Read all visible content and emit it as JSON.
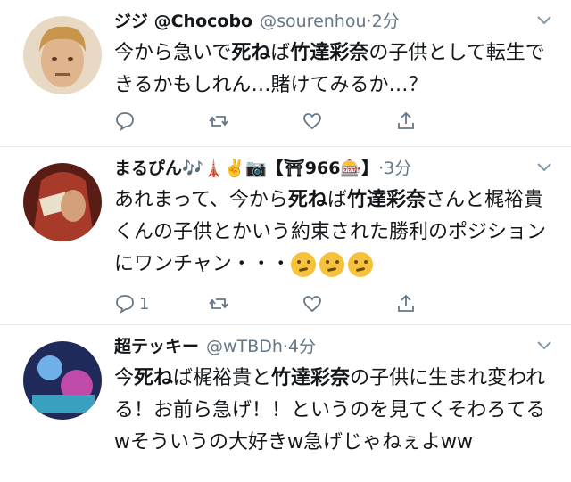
{
  "tweets": [
    {
      "name": "ジジ @Chocobo",
      "handle": "@sourenhou",
      "time": "2分",
      "body_pre": "今から急いで",
      "body_bold1": "死ね",
      "body_mid1": "ば",
      "body_bold2": "竹達彩奈",
      "body_post": "の子供として転生できるかもしれん…賭けてみるか…？",
      "reply_count": "",
      "avatar_color": "#c9a27a"
    },
    {
      "name": "まるぴん🎶🗼✌️📷【⛩966🎰】",
      "handle": "",
      "time": "3分",
      "body_pre": "あれまって、今から",
      "body_bold1": "死ね",
      "body_mid1": "ば",
      "body_bold2": "竹達彩奈",
      "body_post": "さんと梶裕貴くんの子供とかいう約束された勝利のポジションにワンチャン・・・",
      "reply_count": "1",
      "avatar_color": "#8a2e22"
    },
    {
      "name": "超テッキー",
      "handle": "@wTBDh",
      "time": "4分",
      "body_pre": "今",
      "body_bold1": "死ね",
      "body_mid1": "ば梶裕貴と",
      "body_bold2": "竹達彩奈",
      "body_post": "の子供に生まれ変われる！お前ら急げ！！というのを見てくそわろてるwそういうの大好きw急げじゃねぇよww",
      "reply_count": "",
      "avatar_color": "#3a5fa8"
    }
  ],
  "colors": {
    "text": "#14171a",
    "muted": "#657786",
    "divider": "#e6ecf0"
  },
  "icons": [
    "reply-icon",
    "retweet-icon",
    "like-icon",
    "share-icon",
    "caret-down-icon"
  ]
}
